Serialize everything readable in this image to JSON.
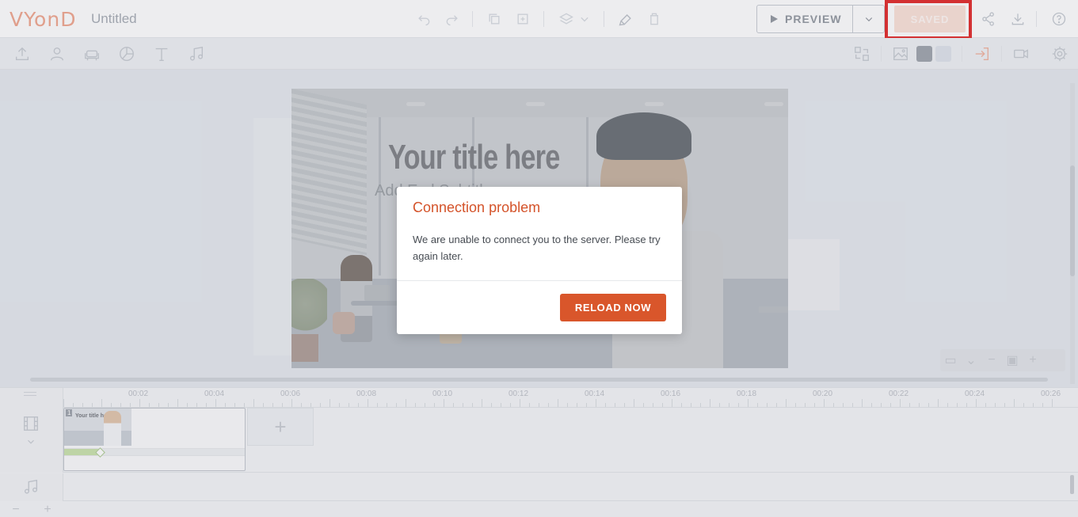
{
  "app": {
    "logo": "VYonD",
    "project_title": "Untitled"
  },
  "topbar": {
    "preview_label": "PREVIEW",
    "saved_label": "SAVED"
  },
  "canvas": {
    "title_text": "Your title here",
    "subtitle_text": "Add  Exd     Subtitl"
  },
  "dialog": {
    "title": "Connection problem",
    "message": "We are unable to connect you to the server. Please try again later.",
    "button_label": "RELOAD NOW"
  },
  "timeline": {
    "ruler_labels": [
      "00:02",
      "00:04",
      "00:06",
      "00:08",
      "00:10",
      "00:12",
      "00:14",
      "00:16",
      "00:18",
      "00:20",
      "00:22",
      "00:24",
      "00:26"
    ],
    "scenes": [
      {
        "number": "1",
        "thumb_title": "Your title here",
        "progress": 0.2
      }
    ]
  },
  "colors": {
    "accent": "#d9562b",
    "dialog_title": "#d4532a",
    "saved_bg": "#fbe0d6",
    "highlight": "#e01e1e",
    "swatch_dark": "#9aa0a8",
    "swatch_light": "#dde2ea"
  }
}
